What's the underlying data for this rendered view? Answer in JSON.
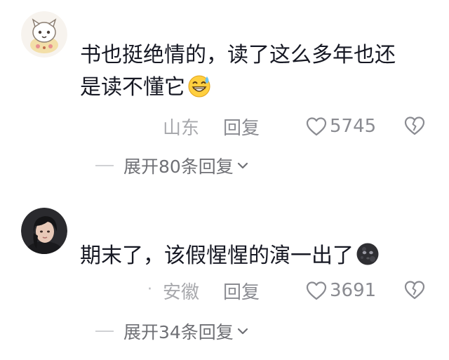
{
  "comments": [
    {
      "avatar_icon": "cartoon-cat-avatar",
      "text_line1": "书也挺绝情的，读了这么多年也还",
      "text_line2": "是读不懂它",
      "emoji_icon": "grinning-sweat-emoji",
      "location": "山东",
      "reply_label": "回复",
      "like_count": "5745",
      "expand_label": "展开80条回复"
    },
    {
      "avatar_icon": "dark-haired-person-avatar",
      "text": "期末了，该假惺惺的演一出了",
      "emoji_icon": "new-moon-face-emoji",
      "location": "安徽",
      "reply_label": "回复",
      "like_count": "3691",
      "expand_label": "展开34条回复"
    }
  ],
  "colors": {
    "primary_text": "#161823",
    "secondary_text": "#8a8b91",
    "location_text": "#a8a9ad"
  }
}
